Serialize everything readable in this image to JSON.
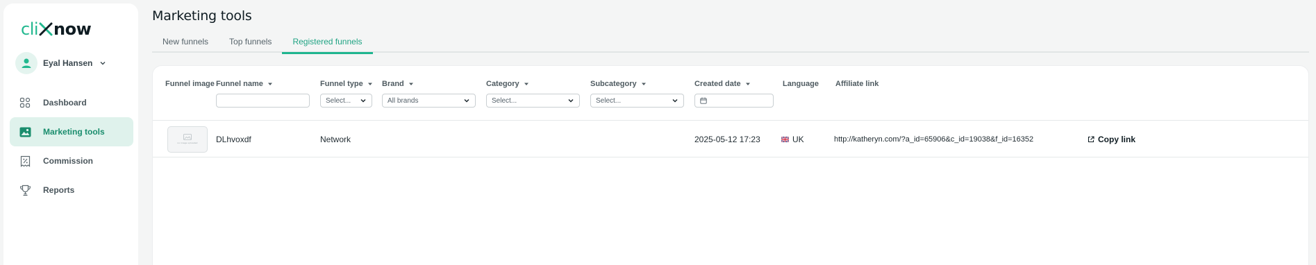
{
  "brand": {
    "part1": "cli",
    "part2": "now"
  },
  "user": {
    "name": "Eyal Hansen"
  },
  "nav": [
    {
      "label": "Dashboard",
      "icon": "dashboard-icon",
      "active": false
    },
    {
      "label": "Marketing tools",
      "icon": "image-icon",
      "active": true
    },
    {
      "label": "Commission",
      "icon": "commission-icon",
      "active": false
    },
    {
      "label": "Reports",
      "icon": "trophy-icon",
      "active": false
    }
  ],
  "page": {
    "title": "Marketing tools"
  },
  "tabs": [
    {
      "label": "New funnels",
      "active": false
    },
    {
      "label": "Top funnels",
      "active": false
    },
    {
      "label": "Registered funnels",
      "active": true
    }
  ],
  "columns": {
    "funnel_image": "Funnel image",
    "funnel_name": "Funnel name",
    "funnel_type": "Funnel type",
    "brand": "Brand",
    "category": "Category",
    "subcategory": "Subcategory",
    "created_date": "Created date",
    "language": "Language",
    "affiliate_link": "Affiliate link"
  },
  "filters": {
    "funnel_name_value": "",
    "funnel_type_value": "Select...",
    "brand_value": "All brands",
    "category_value": "Select...",
    "subcategory_value": "Select...",
    "created_date_value": ""
  },
  "rows": [
    {
      "thumb_label": "no image uploaded",
      "name": "DLhvoxdf",
      "type": "Network",
      "brand": "",
      "category": "",
      "subcategory": "",
      "created": "2025-05-12 17:23",
      "language": "UK",
      "affiliate_link": "http://katheryn.com/?a_id=65906&c_id=19038&f_id=16352",
      "copy_label": "Copy link"
    }
  ],
  "colors": {
    "accent": "#1fb58f",
    "accent_bg": "#dff2ec",
    "text": "#1f2a30"
  }
}
